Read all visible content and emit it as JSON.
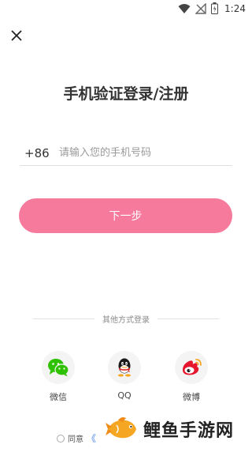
{
  "status_bar": {
    "time": "1:24"
  },
  "title": "手机验证登录/注册",
  "phone": {
    "country_code": "+86",
    "placeholder": "请输入您的手机号码",
    "value": ""
  },
  "next_button": "下一步",
  "other_login": {
    "label": "其他方式登录",
    "options": [
      {
        "label": "微信",
        "icon": "wechat-icon",
        "color": "#2dc100"
      },
      {
        "label": "QQ",
        "icon": "qq-icon",
        "color": "#1a1a1a"
      },
      {
        "label": "微博",
        "icon": "weibo-icon",
        "color": "#e6162d"
      }
    ]
  },
  "agreement": {
    "text": "同意",
    "chevron": "《"
  },
  "watermark": {
    "text": "鲤鱼手游网"
  },
  "colors": {
    "accent": "#f57a9c",
    "link": "#4a86e8"
  }
}
